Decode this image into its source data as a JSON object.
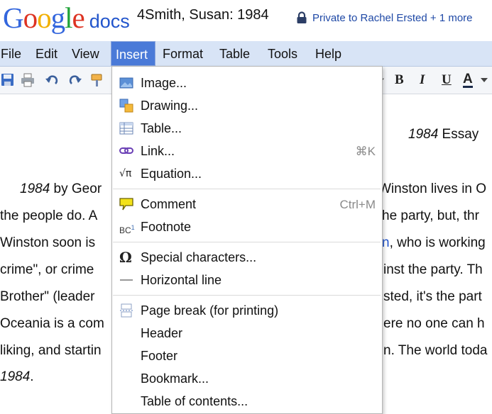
{
  "header": {
    "logo_text": "Google",
    "logo_product": "docs",
    "doc_title": "4Smith, Susan: 1984",
    "share_status": "Private to Rachel Ersted + 1 more",
    "logo_colors": [
      "#3366dd",
      "#dd3322",
      "#f2b000",
      "#3366dd",
      "#22a33a",
      "#dd3322"
    ]
  },
  "menubar": {
    "items": [
      "File",
      "Edit",
      "View",
      "Insert",
      "Format",
      "Table",
      "Tools",
      "Help"
    ],
    "active": "Insert"
  },
  "toolbar": {
    "icons": [
      "save-icon",
      "print-icon",
      "undo-icon",
      "redo-icon",
      "paint-format-icon"
    ],
    "bold": "B",
    "italic": "I",
    "underline": "U",
    "text_color": "A"
  },
  "document": {
    "heading_italic": "1984",
    "heading_rest": " Essay",
    "lines": [
      {
        "italic": "1984",
        "text": " by Geor",
        "right": "Winston lives in O"
      },
      {
        "text": "the people do. A",
        "right": "he party, but, thr"
      },
      {
        "text": "Winston soon is",
        "right_link": "n",
        "right": ", who is working"
      },
      {
        "text": "crime\", or crime",
        "right": "inst the party. Th"
      },
      {
        "text": "Brother\" (leader",
        "right": "sted, it's the part"
      },
      {
        "text": "Oceania is a com",
        "right": "ere no one can h"
      },
      {
        "text": "liking, and startin",
        "right": "n. The world toda"
      },
      {
        "italic": "1984",
        "text": "."
      }
    ]
  },
  "insert_menu": {
    "items": [
      {
        "label": "Image...",
        "icon": "image-icon"
      },
      {
        "label": "Drawing...",
        "icon": "drawing-icon"
      },
      {
        "label": "Table...",
        "icon": "table-icon"
      },
      {
        "label": "Link...",
        "icon": "link-icon",
        "shortcut": "⌘K"
      },
      {
        "label": "Equation...",
        "icon": "equation-icon"
      },
      {
        "label": "Comment",
        "icon": "comment-icon",
        "shortcut": "Ctrl+M"
      },
      {
        "label": "Footnote",
        "icon": "footnote-icon"
      },
      {
        "label": "Special characters...",
        "icon": "omega-icon"
      },
      {
        "label": "Horizontal line",
        "icon": "horizontal-line-icon"
      },
      {
        "label": "Page break (for printing)",
        "icon": "page-break-icon"
      },
      {
        "label": "Header"
      },
      {
        "label": "Footer"
      },
      {
        "label": "Bookmark..."
      },
      {
        "label": "Table of contents..."
      }
    ],
    "icon_glyphs": {
      "equation": "√π",
      "footnote": "BC",
      "footnote_sup": "1",
      "omega": "Ω"
    }
  },
  "colors": {
    "menubar_bg": "#d8e4f6",
    "menu_active_bg": "#4a7ad8",
    "link": "#2255cc",
    "share_text": "#1f49a6"
  }
}
